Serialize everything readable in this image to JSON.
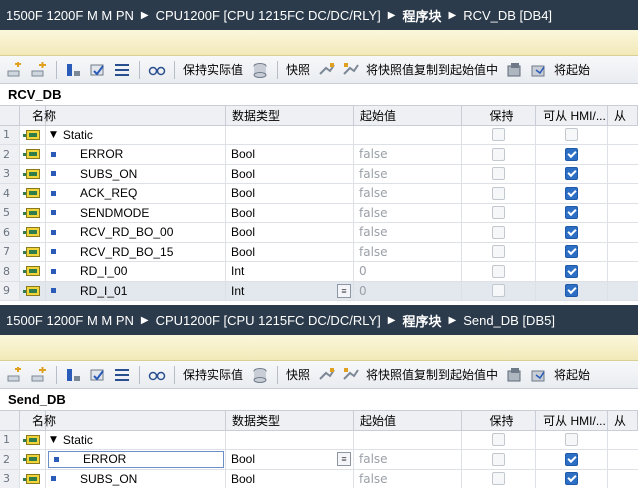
{
  "panels": [
    {
      "breadcrumb": [
        "1500F 1200F M M PN",
        "CPU1200F [CPU 1215FC DC/DC/RLY]",
        "程序块",
        "RCV_DB [DB4]"
      ],
      "toolbar": {
        "keep_actual": "保持实际值",
        "snapshot": "快照",
        "copy_snapshot": "将快照值复制到起始值中",
        "load_start": "将起始"
      },
      "db_name": "RCV_DB",
      "headers": {
        "name": "名称",
        "type": "数据类型",
        "start": "起始值",
        "retain": "保持",
        "hmi": "可从 HMI/...",
        "more": "从"
      },
      "rows": [
        {
          "num": "1",
          "name": "Static",
          "type": "",
          "start": "",
          "static": true,
          "retain": false,
          "hmi": false
        },
        {
          "num": "2",
          "name": "ERROR",
          "type": "Bool",
          "start": "false",
          "retain": false,
          "hmi": true
        },
        {
          "num": "3",
          "name": "SUBS_ON",
          "type": "Bool",
          "start": "false",
          "retain": false,
          "hmi": true
        },
        {
          "num": "4",
          "name": "ACK_REQ",
          "type": "Bool",
          "start": "false",
          "retain": false,
          "hmi": true
        },
        {
          "num": "5",
          "name": "SENDMODE",
          "type": "Bool",
          "start": "false",
          "retain": false,
          "hmi": true
        },
        {
          "num": "6",
          "name": "RCV_RD_BO_00",
          "type": "Bool",
          "start": "false",
          "retain": false,
          "hmi": true
        },
        {
          "num": "7",
          "name": "RCV_RD_BO_15",
          "type": "Bool",
          "start": "false",
          "retain": false,
          "hmi": true
        },
        {
          "num": "8",
          "name": "RD_I_00",
          "type": "Int",
          "start": "0",
          "retain": false,
          "hmi": true
        },
        {
          "num": "9",
          "name": "RD_I_01",
          "type": "Int",
          "start": "0",
          "retain": false,
          "hmi": true,
          "selected": true
        }
      ]
    },
    {
      "breadcrumb": [
        "1500F 1200F M M PN",
        "CPU1200F [CPU 1215FC DC/DC/RLY]",
        "程序块",
        "Send_DB [DB5]"
      ],
      "toolbar": {
        "keep_actual": "保持实际值",
        "snapshot": "快照",
        "copy_snapshot": "将快照值复制到起始值中",
        "load_start": "将起始"
      },
      "db_name": "Send_DB",
      "headers": {
        "name": "名称",
        "type": "数据类型",
        "start": "起始值",
        "retain": "保持",
        "hmi": "可从 HMI/...",
        "more": "从"
      },
      "rows": [
        {
          "num": "1",
          "name": "Static",
          "type": "",
          "start": "",
          "static": true,
          "retain": false,
          "hmi": false
        },
        {
          "num": "2",
          "name": "ERROR",
          "type": "Bool",
          "start": "false",
          "retain": false,
          "hmi": true,
          "editing": true
        },
        {
          "num": "3",
          "name": "SUBS_ON",
          "type": "Bool",
          "start": "false",
          "retain": false,
          "hmi": true
        }
      ]
    }
  ],
  "colors": {
    "breadcrumb_bg": "#2c3b4b",
    "band": "#f2e9b8",
    "checkbox_on": "#2d6fc4",
    "bullet": "#2a5bb8"
  },
  "icons": [
    "add-row-icon",
    "insert-row-icon",
    "expand-icon",
    "collapse-icon",
    "list-icon",
    "glasses-icon",
    "db-keep-icon",
    "snapshot-icon",
    "copy-snapshot-icon",
    "load-icon",
    "more-icon"
  ]
}
